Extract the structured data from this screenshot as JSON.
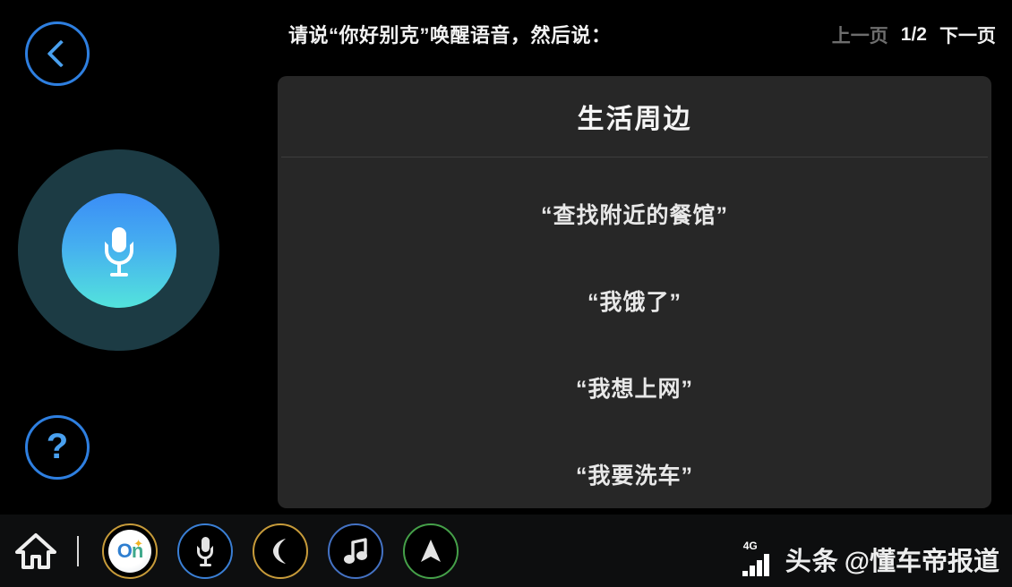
{
  "header": {
    "prompt": "请说“你好别克”唤醒语音，然后说：",
    "pager": {
      "prev_label": "上一页",
      "count": "1/2",
      "next_label": "下一页"
    }
  },
  "left_rail": {
    "back_icon": "chevron-left-icon",
    "help_icon": "question-mark-icon",
    "mic_icon": "microphone-icon",
    "accent_blue": "#2e7fe0",
    "mic_gradient_from": "#3b8df6",
    "mic_gradient_to": "#53e3dc",
    "mic_ring_color": "#1c3b44"
  },
  "card": {
    "title": "生活周边",
    "background": "#272727",
    "commands": [
      {
        "text": "“查找附近的餐馆”"
      },
      {
        "text": "“我饿了”"
      },
      {
        "text": "“我想上网”"
      },
      {
        "text": "“我要洗车”"
      }
    ]
  },
  "navbar": {
    "background": "#0d0e0f",
    "items": [
      {
        "name": "home",
        "icon": "home-icon",
        "label": "",
        "ring": ""
      },
      {
        "name": "onstar",
        "icon": "onstar-logo-icon",
        "label": "On",
        "ring": "#c79b3a"
      },
      {
        "name": "voice",
        "icon": "microphone-icon",
        "label": "",
        "ring": "#3a7fd5"
      },
      {
        "name": "phone",
        "icon": "phone-icon",
        "label": "",
        "ring": "#c79b3a"
      },
      {
        "name": "music",
        "icon": "music-note-icon",
        "label": "",
        "ring": "#4472c4"
      },
      {
        "name": "navigation",
        "icon": "navigation-arrow-icon",
        "label": "",
        "ring": "#45a049"
      }
    ]
  },
  "status": {
    "network_type": "4G",
    "signal_icon": "signal-bars-icon",
    "signal_bars": 4,
    "watermark_brand": "头条",
    "watermark_handle": "@懂车帝报道",
    "watermark_at_icon": "at-sign-icon"
  }
}
